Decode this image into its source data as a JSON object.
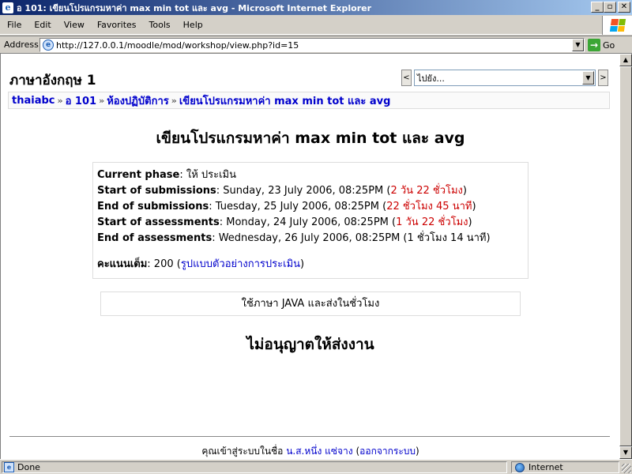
{
  "window": {
    "title": "อ 101: เขียนโปรแกรมหาค่า max min tot และ avg - Microsoft Internet Explorer",
    "btn_min": "_",
    "btn_max": "▫",
    "btn_close": "✕",
    "icon": "ie-icon"
  },
  "menu": {
    "items": [
      "File",
      "Edit",
      "View",
      "Favorites",
      "Tools",
      "Help"
    ]
  },
  "address": {
    "label": "Address",
    "url": "http://127.0.0.1/moodle/mod/workshop/view.php?id=15",
    "go_label": "Go"
  },
  "page": {
    "course_title": "ภาษาอังกฤษ 1",
    "jump_select": "ไปยัง...",
    "nav_prev": "<",
    "nav_next": ">",
    "breadcrumb": [
      "thaiabc",
      "อ 101",
      "ห้องปฏิบัติการ",
      "เขียนโปรแกรมหาค่า max min tot และ avg"
    ],
    "breadcrumb_sep": "»",
    "heading": "เขียนโปรแกรมหาค่า max min tot และ avg",
    "info": {
      "current_phase_label": "Current phase",
      "current_phase_value": ": ให้ ประเมิน",
      "start_sub_label": "Start of submissions",
      "start_sub_value": ": Sunday, 23 July 2006, 08:25PM (",
      "start_sub_remaining": "2 วัน 22 ชั่วโมง",
      "end_sub_label": "End of submissions",
      "end_sub_value": ": Tuesday, 25 July 2006, 08:25PM (",
      "end_sub_remaining": "22 ชั่วโมง 45 นาที",
      "start_ass_label": "Start of assessments",
      "start_ass_value": ": Monday, 24 July 2006, 08:25PM (",
      "start_ass_remaining": "1 วัน 22 ชั่วโมง",
      "end_ass_label": "End of assessments",
      "end_ass_value": ": Wednesday, 26 July 2006, 08:25PM (1 ชั่วโมง 14 นาที)",
      "close_paren": ")",
      "grade_label": "คะแนนเต็ม",
      "grade_value": ": 200 (",
      "grade_link": "รูปแบบตัวอย่างการประเมิน"
    },
    "description": "ใช้ภาษา JAVA และส่งในชั่วโมง",
    "not_allowed": "ไม่อนุญาตให้ส่งงาน",
    "footer": {
      "prefix": "คุณเข้าสู่ระบบในชื่อ ",
      "user_link": "น.ส.หนึ่ง แซ่จาง",
      "open_paren": " (",
      "logout_link": "ออกจากระบบ",
      "close_paren": ")"
    }
  },
  "status": {
    "left": "Done",
    "zone": "Internet"
  },
  "colors": {
    "titlebar_start": "#0a246a",
    "titlebar_end": "#a6caf0",
    "link": "#0000cc",
    "remaining_red": "#cc0000",
    "chrome": "#d4d0c8"
  }
}
